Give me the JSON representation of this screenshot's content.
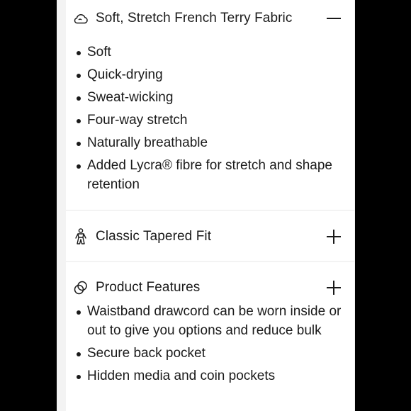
{
  "sections": [
    {
      "title": "Soft, Stretch French Terry Fabric",
      "icon": "cloud-icon",
      "state": "expanded",
      "items": [
        "Soft",
        "Quick-drying",
        "Sweat-wicking",
        "Four-way stretch",
        "Naturally breathable",
        "Added Lycra® fibre for stretch and shape retention"
      ]
    },
    {
      "title": "Classic Tapered Fit",
      "icon": "figure-icon",
      "state": "collapsed"
    },
    {
      "title": "Product Features",
      "icon": "features-icon",
      "state": "collapsed",
      "items": [
        "Waistband drawcord can be worn inside or out to give you options and reduce bulk",
        "Secure back pocket",
        "Hidden media and coin pockets"
      ]
    }
  ]
}
